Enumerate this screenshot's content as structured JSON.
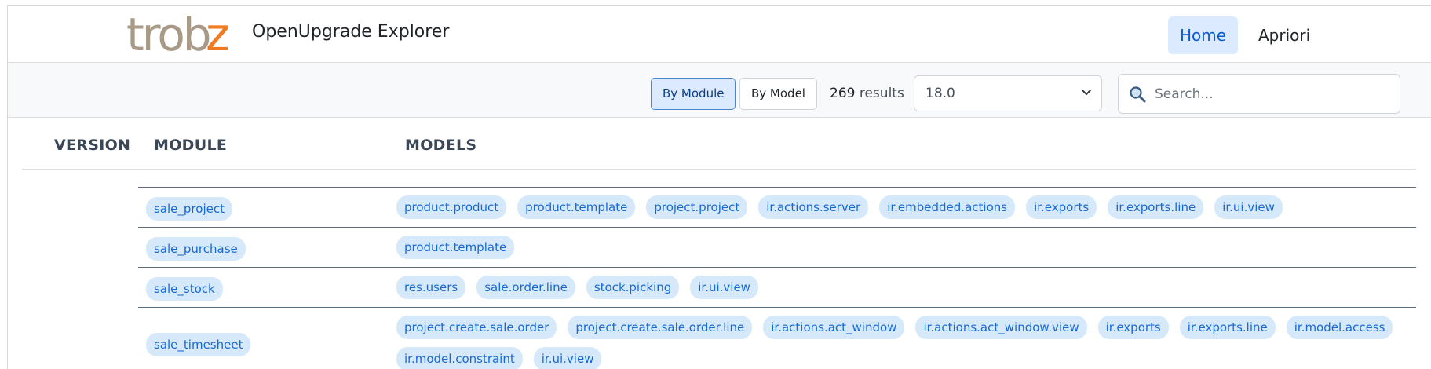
{
  "navbar": {
    "brand_logo_text": "trobz",
    "brand_title": "OpenUpgrade Explorer",
    "links": [
      {
        "label": "Home",
        "active": true
      },
      {
        "label": "Apriori",
        "active": false
      }
    ]
  },
  "toolbar": {
    "by_module_label": "By Module",
    "by_model_label": "By Model",
    "result_count": "269",
    "result_suffix": " results",
    "version_value": "18.0",
    "search_placeholder": "Search..."
  },
  "table": {
    "headers": {
      "version": "VERSION",
      "module": "MODULE",
      "models": "MODELS"
    },
    "rows": [
      {
        "module": "sale_project",
        "models": [
          "product.product",
          "product.template",
          "project.project",
          "ir.actions.server",
          "ir.embedded.actions",
          "ir.exports",
          "ir.exports.line",
          "ir.ui.view"
        ]
      },
      {
        "module": "sale_purchase",
        "models": [
          "product.template"
        ]
      },
      {
        "module": "sale_stock",
        "models": [
          "res.users",
          "sale.order.line",
          "stock.picking",
          "ir.ui.view"
        ]
      },
      {
        "module": "sale_timesheet",
        "models": [
          "project.create.sale.order",
          "project.create.sale.order.line",
          "ir.actions.act_window",
          "ir.actions.act_window.view",
          "ir.exports",
          "ir.exports.line",
          "ir.model.access",
          "ir.model.constraint",
          "ir.ui.view"
        ]
      }
    ]
  },
  "colors": {
    "accent": "#1769d4",
    "tag_bg": "#d6e9fb",
    "logo_gray": "#a89a86",
    "logo_orange": "#f07a1f"
  },
  "icons": {
    "search": "search-icon",
    "select_chevron": "chevron-down-icon"
  }
}
